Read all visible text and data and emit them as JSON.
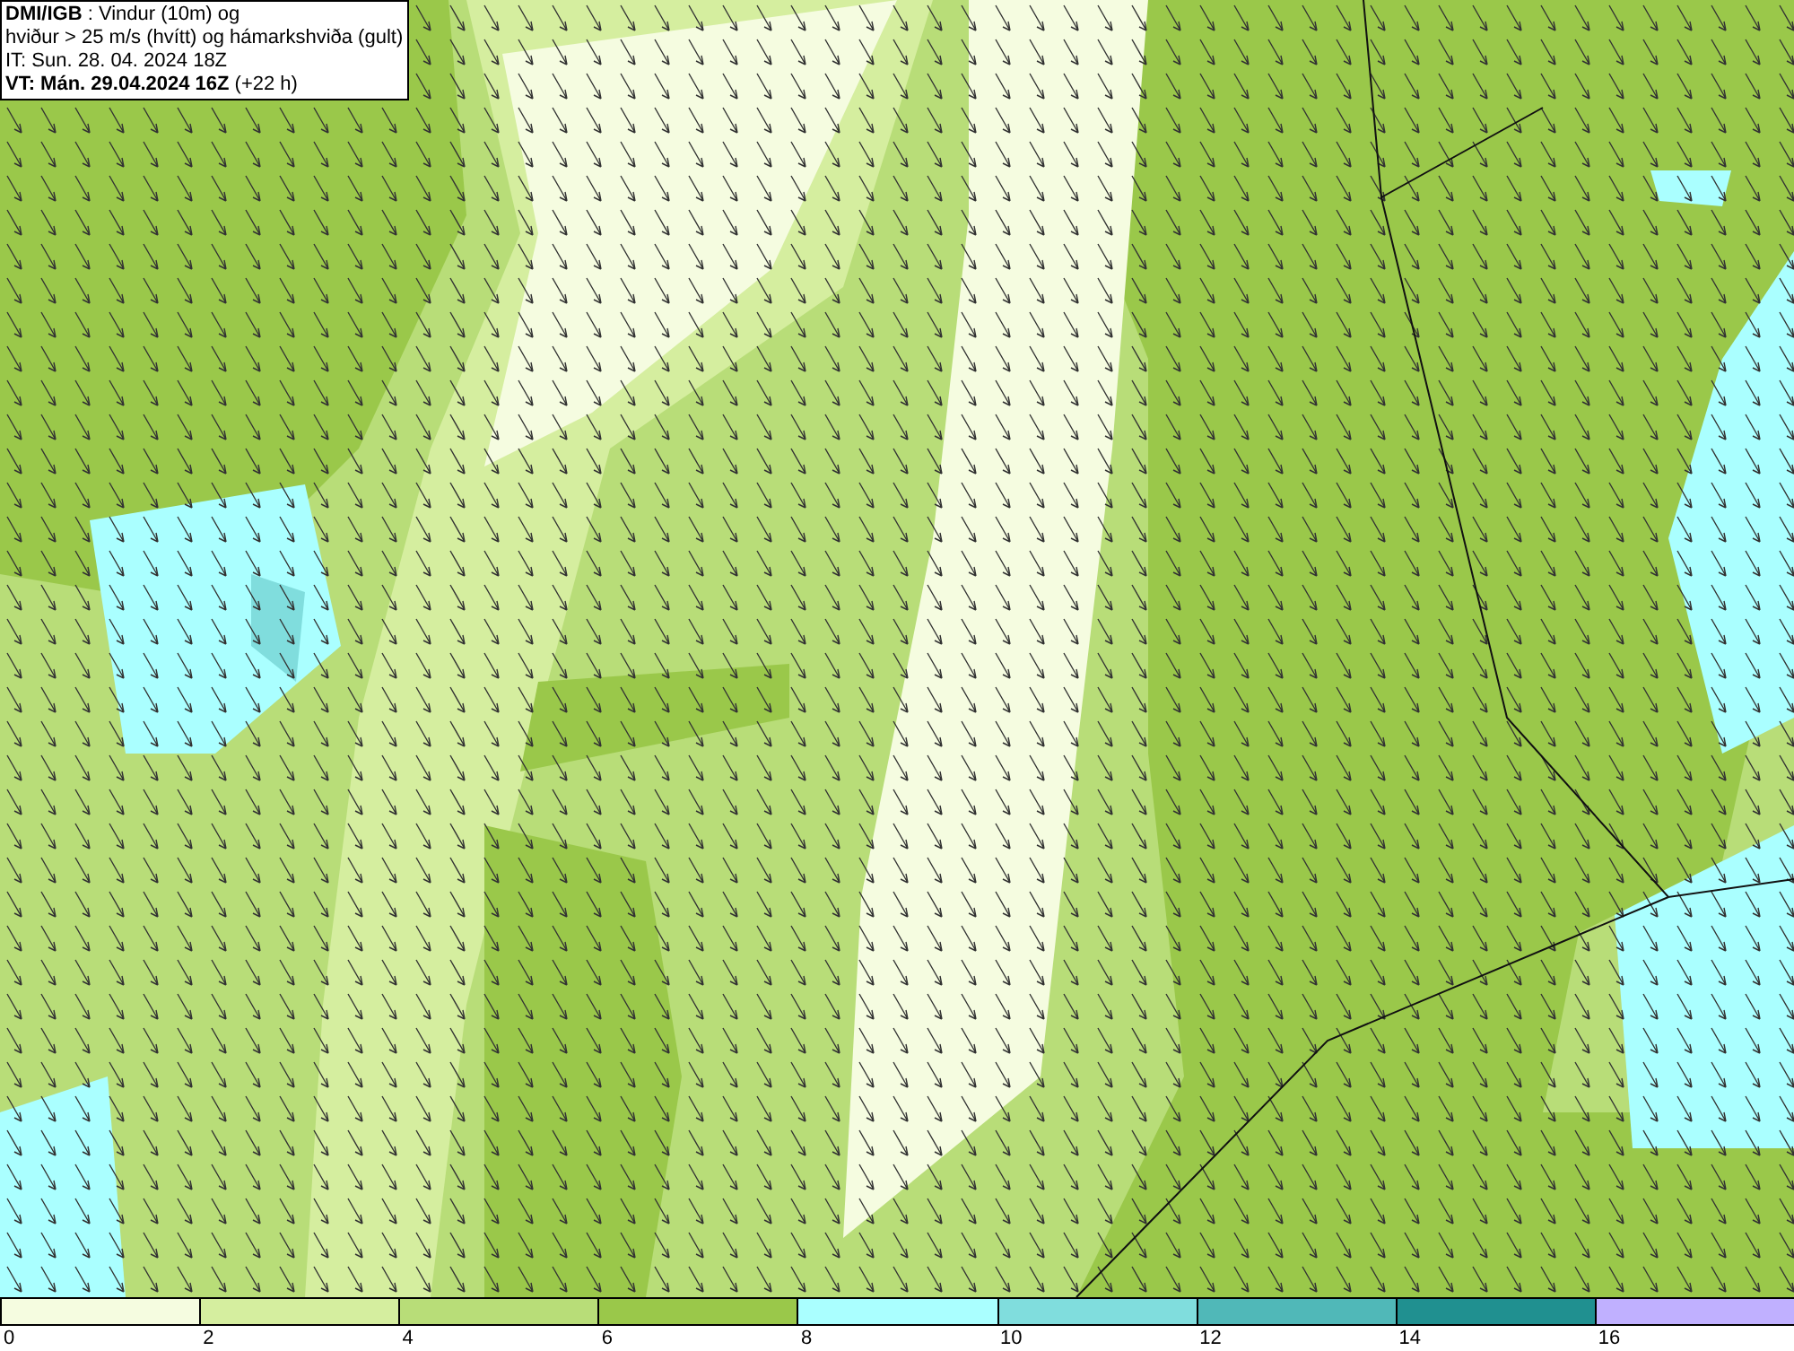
{
  "info_box": {
    "lines": [
      "**DMI/IGB** : Vindur (10m) og",
      "hviður > 25 m/s (hvítt) og hámarkshviða (gult)",
      "IT: Sun. 28. 04. 2024 18Z",
      "**VT: Mán. 29.04.2024 16Z** (+22 h)"
    ]
  },
  "legend": {
    "segments": [
      {
        "color": "#f5fce0"
      },
      {
        "color": "#d5ee9f"
      },
      {
        "color": "#b8dd78"
      },
      {
        "color": "#9ac84a"
      },
      {
        "color": "#aaffff"
      },
      {
        "color": "#80dddd"
      },
      {
        "color": "#50b8b8"
      },
      {
        "color": "#209090"
      },
      {
        "color": "#c0b0ff"
      }
    ],
    "ticks": [
      "0",
      "2",
      "4",
      "6",
      "8",
      "10",
      "12",
      "14",
      "16"
    ]
  }
}
